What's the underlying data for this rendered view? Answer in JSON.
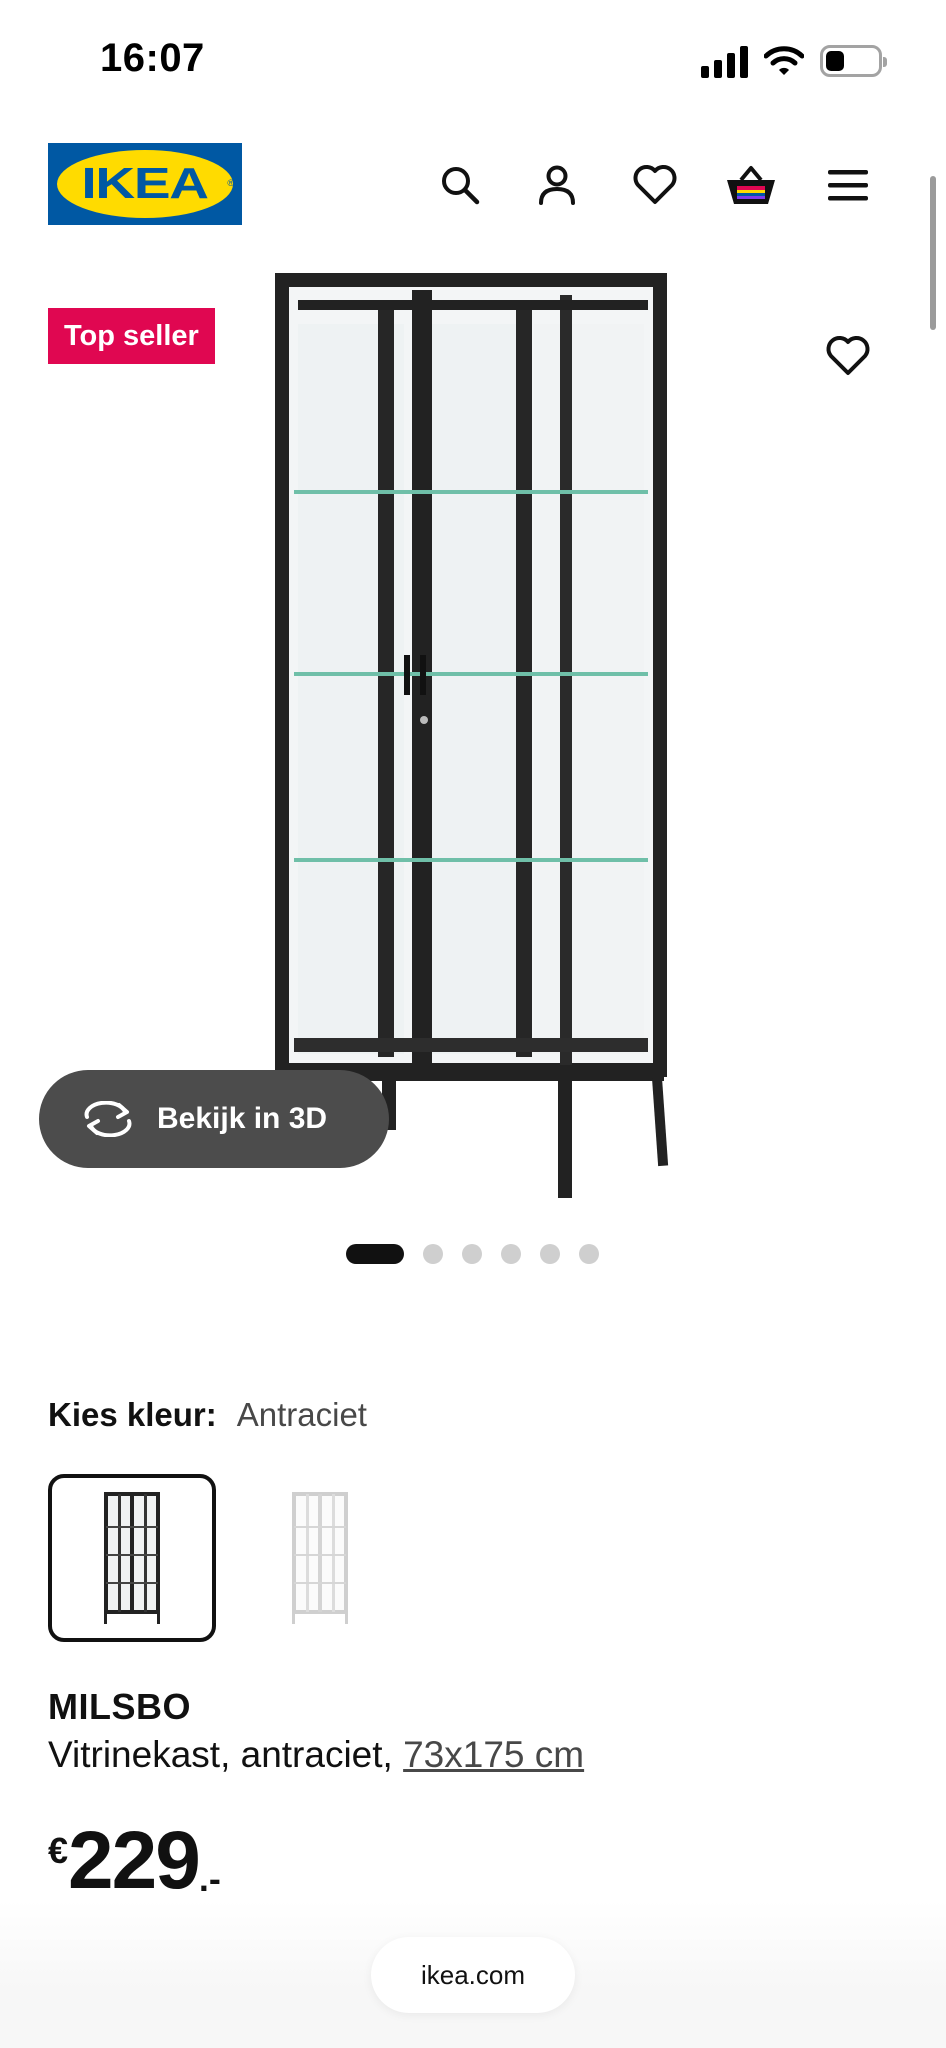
{
  "status_bar": {
    "time": "16:07",
    "battery_level": 0.3
  },
  "header": {
    "logo_text": "IKEA",
    "icons": [
      "search-icon",
      "user-icon",
      "heart-icon",
      "basket-icon",
      "menu-icon"
    ]
  },
  "product_image": {
    "badge": "Top seller",
    "view_3d_label": "Bekijk in 3D",
    "carousel": {
      "total": 6,
      "active_index": 0
    }
  },
  "color": {
    "label": "Kies kleur:",
    "value": "Antraciet",
    "options": [
      {
        "color": "#2b2b2b",
        "selected": true
      },
      {
        "color": "#ffffff",
        "selected": false
      }
    ]
  },
  "product": {
    "name": "MILSBO",
    "description": "Vitrinekast, antraciet,",
    "dimensions": "73x175 cm"
  },
  "price": {
    "currency": "€",
    "amount": "229",
    "suffix": ".-"
  },
  "browser": {
    "url": "ikea.com"
  },
  "colors": {
    "badge": "#e00751",
    "ikea_blue": "#0058a3",
    "ikea_yellow": "#ffdb00"
  }
}
